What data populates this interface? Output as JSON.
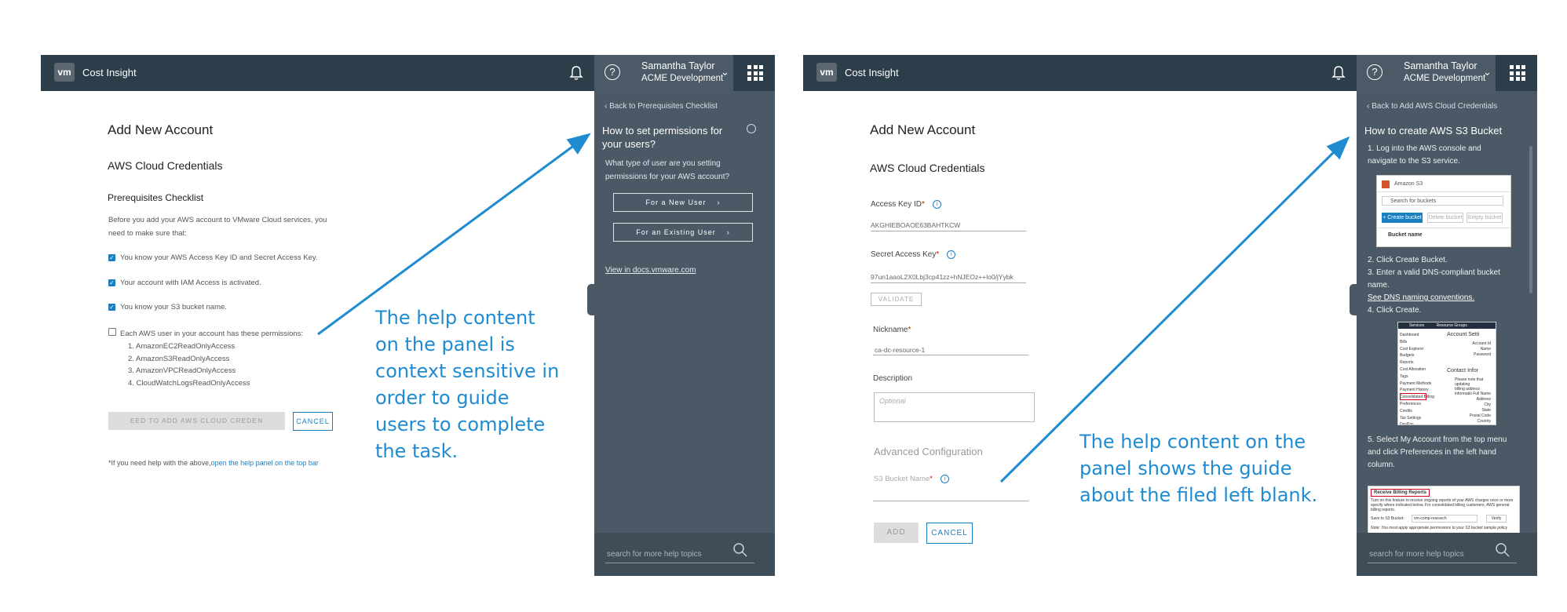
{
  "left": {
    "topbar": {
      "logo_text": "vm",
      "app_name": "Cost Insight",
      "user_name": "Samantha Taylor",
      "user_org": "ACME Development"
    },
    "help_panel": {
      "back_link": "Back to Prerequisites Checklist",
      "title": "How to set permissions for your users?",
      "description": "What type of user are you setting permissions for your AWS account?",
      "option_new": "For a New User",
      "option_existing": "For an Existing User",
      "docs_link": "View in docs.vmware.com",
      "search_placeholder": "search for more help topics"
    },
    "form": {
      "title": "Add New Account",
      "subtitle": "AWS Cloud Credentials",
      "section": "Prerequisites Checklist",
      "intro_line1": "Before you add your AWS account to VMware Cloud services, you",
      "intro_line2": "need to make sure that:",
      "checks": [
        "You know your AWS Access Key ID and Secret Access Key.",
        "Your account with IAM Access is activated.",
        "You know your S3 bucket name."
      ],
      "permissions_label": "Each AWS user in your account has these permissions:",
      "permissions": [
        "1. AmazonEC2ReadOnlyAccess",
        "2. AmazonS3ReadOnlyAccess",
        "3. AmazonVPCReadOnlyAccess",
        "4. CloudWatchLogsReadOnlyAccess"
      ],
      "proceed_button": "EED TO ADD AWS CLOUD CREDEN",
      "cancel_button": "CANCEL",
      "footnote_prefix": "*If you need help with the above,",
      "footnote_link": "open the help panel on the top bar"
    },
    "annotation": [
      "The help content",
      "on the panel is",
      "context sensitive in",
      "order to guide",
      "users to complete",
      "the task."
    ]
  },
  "right": {
    "topbar": {
      "logo_text": "vm",
      "app_name": "Cost Insight",
      "user_name": "Samantha Taylor",
      "user_org": "ACME Development"
    },
    "help_panel": {
      "back_link": "Back to Add AWS Cloud Credentials",
      "title": "How to create AWS S3 Bucket",
      "step1_line1": "1. Log into the AWS console and",
      "step1_line2": "navigate to the S3 service.",
      "step2": "2. Click Create Bucket.",
      "step3_line1": "3. Enter a valid DNS-compliant bucket",
      "step3_line2": "name.",
      "dns_link": "See DNS naming conventions.",
      "step4": "4. Click Create.",
      "step5_line1": "5. Select My Account from the top menu",
      "step5_line2": "and click Preferences in the left hand",
      "step5_line3": "column.",
      "search_placeholder": "search for more help topics",
      "s3_shot": {
        "header": "Amazon S3",
        "search": "Search for buckets",
        "create": "+ Create bucket",
        "delete": "Delete bucket",
        "empty": "Empty bucket",
        "col": "Bucket name"
      },
      "account_shot": {
        "menu1": "Services",
        "menu2": "Resource Groups",
        "items": [
          "Dashboard",
          "Bills",
          "Cost Explorer",
          "Budgets",
          "Reports",
          "Cost Allocation Tags",
          "Payment Methods",
          "Payment History",
          "Consolidated Billing",
          "Preferences",
          "Credits",
          "Tax Settings",
          "DevPay"
        ],
        "heading1": "Account Setti",
        "fields1": [
          "Account Id",
          "Name",
          "Password"
        ],
        "heading2": "Contact Infor",
        "note": [
          "Please note that updating",
          "billing address informatio"
        ],
        "fields2": [
          "Full Name",
          "Address",
          "City",
          "State",
          "Postal Code",
          "Country"
        ]
      },
      "billing_shot": {
        "heading": "Receive Billing Reports",
        "text1": "Turn on this feature to receive ongoing reports of your AWS charges once or more",
        "text2": "specify where indicated below. For consolidated billing customers, AWS generat",
        "text3": "billing reports.",
        "save_label": "Save to S3 Bucket:",
        "bucket": "vm-comp-research",
        "verify": "Verify",
        "note": "Note: You must apply appropriate permissions to your S3 bucket sample policy"
      }
    },
    "form": {
      "title": "Add New Account",
      "subtitle": "AWS Cloud Credentials",
      "access_key_label": "Access Key ID",
      "access_key_value": "AKGHIEBOAOE63BAHTKCW",
      "secret_label": "Secret Access Key",
      "secret_value": "97un1aaoL2X0Lbj3cp41zz+hNJEOz++lo0/jYybk",
      "validate_button": "VALIDATE",
      "nickname_label": "Nickname",
      "nickname_value": "ca-dc-resource-1",
      "description_label": "Description",
      "description_placeholder": "Optional",
      "advanced_label": "Advanced Configuration",
      "bucket_label": "S3 Bucket Name",
      "add_button": "ADD",
      "cancel_button": "CANCEL"
    },
    "annotation": [
      "The help content on the",
      "panel shows the guide",
      "about the filed left blank."
    ]
  },
  "colors": {
    "topbar": "#2d3e4b",
    "help_panel": "#4a5965",
    "accent_blue": "#1a7fc0",
    "annotation_blue": "#1f8bd1"
  }
}
